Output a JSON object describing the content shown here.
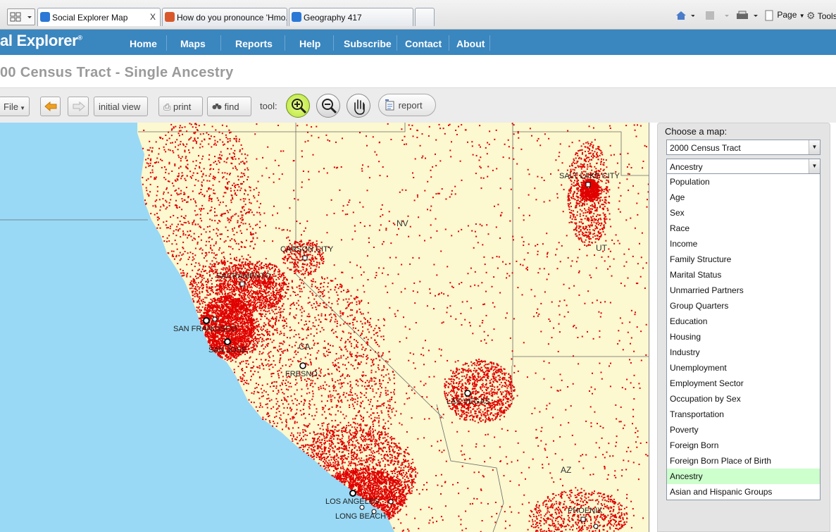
{
  "browser": {
    "tabs": [
      {
        "title": "Social Explorer Map",
        "active": true
      },
      {
        "title": "How do you pronounce 'Hmo...",
        "active": false
      },
      {
        "title": "Geography 417",
        "active": false
      }
    ],
    "close_glyph": "X",
    "commands": {
      "page": "Page",
      "tools": "Tools"
    }
  },
  "site": {
    "logo": "al Explorer",
    "logo_mark": "®",
    "nav": [
      "Home",
      "Maps",
      "Reports",
      "Help",
      "Subscribe",
      "Contact",
      "About"
    ]
  },
  "page_title": "00 Census Tract - Single Ancestry",
  "toolbar": {
    "file": "File",
    "initial_view": "initial view",
    "print": "print",
    "find": "find",
    "tool_label": "tool:",
    "report": "report",
    "active_tool": "zoom-in"
  },
  "map": {
    "land_color": "#fcf8cf",
    "water_color": "#99d9f5",
    "dot_color": "#e00000",
    "states": [
      "NV",
      "UT",
      "CA",
      "AZ"
    ],
    "cities": [
      "SALT LAKE CITY",
      "CARSON CITY",
      "SACRAMENTO",
      "SAN FRANCISCO",
      "SAN JOSE",
      "FRESNO",
      "LAS VEGAS",
      "LOS ANGELES",
      "LONG BEACH",
      "PHOENIX"
    ]
  },
  "panel": {
    "choose_label": "Choose a map:",
    "survey_select": "2000 Census Tract",
    "category_select": "Ancestry",
    "options": [
      "Population",
      "Age",
      "Sex",
      "Race",
      "Income",
      "Family Structure",
      "Marital Status",
      "Unmarried Partners",
      "Group Quarters",
      "Education",
      "Housing",
      "Industry",
      "Unemployment",
      "Employment Sector",
      "Occupation by Sex",
      "Transportation",
      "Poverty",
      "Foreign Born",
      "Foreign Born Place of Birth",
      "Ancestry",
      "Asian and Hispanic Groups"
    ],
    "selected_option": "Ancestry"
  }
}
